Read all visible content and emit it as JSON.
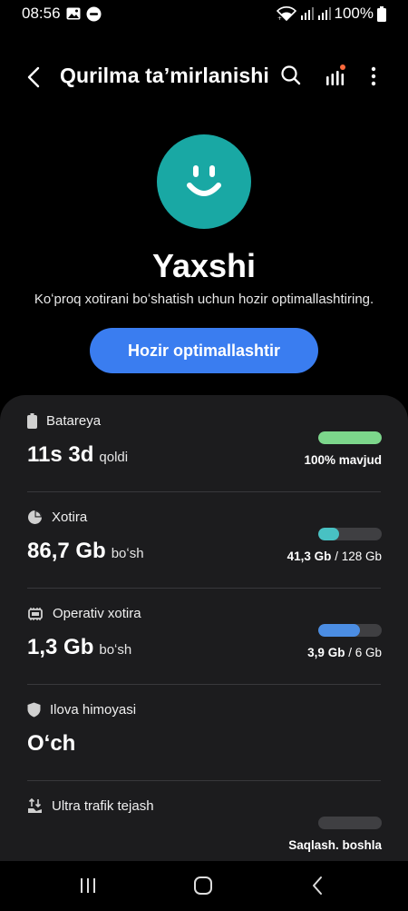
{
  "status_bar": {
    "time": "08:56",
    "battery_percent": "100%"
  },
  "app_bar": {
    "title": "Qurilma ta’mirlanishi"
  },
  "hero": {
    "status": "Yaxshi",
    "message": "Koʻproq xotirani boʻshatish uchun hozir optimallashtiring.",
    "button_label": "Hozir optimallashtir",
    "face_color": "#19a8a4"
  },
  "rows": {
    "battery": {
      "label": "Batareya",
      "value": "11s 3d",
      "unit": "qoldi",
      "right_bold": "100% mavjud",
      "fill_fraction": 1.0,
      "fill_color": "#7cd68b"
    },
    "storage": {
      "label": "Xotira",
      "value": "86,7 Gb",
      "unit": "boʻsh",
      "used": "41,3 Gb",
      "total": "128 Gb",
      "fill_fraction": 0.33,
      "fill_color": "#48c1c3"
    },
    "ram": {
      "label": "Operativ xotira",
      "value": "1,3 Gb",
      "unit": "boʻsh",
      "used": "3,9 Gb",
      "total": "6 Gb",
      "fill_fraction": 0.65,
      "fill_color": "#4b8de3"
    },
    "protection": {
      "label": "Ilova himoyasi",
      "value": "Oʻch"
    },
    "data_saver": {
      "label": "Ultra trafik tejash",
      "right_bold": "Saqlash. boshla",
      "fill_fraction": 0.0,
      "fill_color": "#3f3f42"
    }
  },
  "nav": {
    "recents": "recents-icon",
    "home": "home-icon",
    "back": "back-icon"
  },
  "colors": {
    "accent": "#3a7df0",
    "card_bg": "#1c1c1e",
    "notification_dot": "#ff6a3d"
  }
}
